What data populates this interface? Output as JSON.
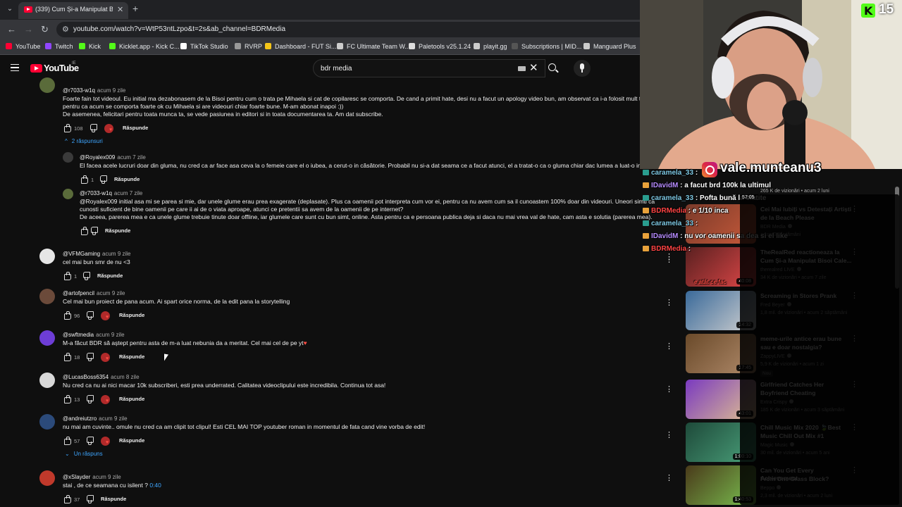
{
  "browser": {
    "tab_title": "(339) Cum Și-a Manipulat Bisoi",
    "url": "youtube.com/watch?v=WtP53ntLzpo&t=2s&ab_channel=BDRMedia",
    "bookmarks": [
      {
        "label": "YouTube",
        "color": "#ff0033"
      },
      {
        "label": "Twitch",
        "color": "#9146ff"
      },
      {
        "label": "Kick",
        "color": "#53fc18"
      },
      {
        "label": "Kicklet.app - Kick C...",
        "color": "#53fc18"
      },
      {
        "label": "TikTok Studio",
        "color": "#ffffff"
      },
      {
        "label": "RVRP",
        "color": "#999999"
      },
      {
        "label": "Dashboard - FUT Si...",
        "color": "#f5c518"
      },
      {
        "label": "FC Ultimate Team W...",
        "color": "#cccccc"
      },
      {
        "label": "Paletools v25.1.24",
        "color": "#dddddd"
      },
      {
        "label": "playit.gg",
        "color": "#cccccc"
      },
      {
        "label": "Subscriptions | MID...",
        "color": "#555555"
      },
      {
        "label": "Manguard Plus",
        "color": "#cccccc"
      }
    ]
  },
  "masthead": {
    "logo_text": "YouTube",
    "logo_country": "IE",
    "search_value": "bdr media"
  },
  "comments": [
    {
      "author": "@r7033-w1q",
      "time": "acum 9 zile",
      "lines": [
        "Foarte fain tot videoul. Eu initial ma dezabonasem de la Bisoi pentru cum o trata pe Mihaela si cat de copilaresc se comporta. De cand a primit hate, desi nu a facut un apology video bun, am observat ca i-a folosit mult tot",
        "pentru ca acum se comporta foarte ok cu Mihaela si are videouri chiar foarte bune. M-am abonat inapoi :))",
        "De asemenea, felicitari pentru toata munca ta, se vede pasiunea in editori si in toata documentarea ta. Am dat subscribe."
      ],
      "likes": "108",
      "reply": "Răspunde",
      "replies_toggle": "2 răspunsuri"
    },
    {
      "author": "@Royalex009",
      "time": "acum 7 zile",
      "lines": [
        "El facea acele lucruri doar din gluma, nu cred ca ar face asa ceva la o femeie care el o iubea, a cerut-o in căsătorie. Probabil nu si-a dat seama ce a facut atunci, el a tratat-o ca o gluma chiar dac lumea a luat-o in seri"
      ],
      "likes": "1",
      "reply": "Răspunde"
    },
    {
      "author": "@r7033-w1q",
      "time": "acum 7 zile",
      "lines": [
        "@Royalex009 initial asa mi se parea si mie, dar unele glume erau prea exagerate (deplasate). Plus ca oamenii pot interpreta cum vor ei, pentru ca nu avem cum sa il cunoastem 100% doar din videouri. Uneori simti ca",
        "cunosti suficient de bine oamenii pe care ii ai de o viata aproape, atunci ce pretentii sa avem de la oamenii de pe internet?",
        "De aceea, parerea mea e ca unele glume trebuie tinute doar offline, iar glumele care sunt cu bun simt, online. Asta pentru ca e persoana publica deja si daca nu mai vrea val de hate, cam asta e solutia (parerea mea)."
      ],
      "likes": "",
      "reply": "Răspunde"
    },
    {
      "author": "@VFMGaming",
      "time": "acum 9 zile",
      "lines": [
        "cel mai bun smr de nu <3"
      ],
      "likes": "1",
      "reply": "Răspunde"
    },
    {
      "author": "@artofpencil",
      "time": "acum 9 zile",
      "lines": [
        "Cel mai bun proiect de pana acum. Ai spart orice norma, de la edit pana la storytelling"
      ],
      "likes": "96",
      "reply": "Răspunde"
    },
    {
      "author": "@swftmedia",
      "time": "acum 9 zile",
      "lines": [
        "M-a făcut BDR să aștept pentru asta de m-a luat nebunia da a meritat. Cel mai cel de pe yt"
      ],
      "likes": "18",
      "reply": "Răspunde"
    },
    {
      "author": "@LucasBoss6354",
      "time": "acum 8 zile",
      "lines": [
        "Nu cred ca nu ai nici macar 10k subscriberi, esti prea underrated. Calitatea videoclipului este incredibila. Continua tot asa!"
      ],
      "likes": "13",
      "reply": "Răspunde"
    },
    {
      "author": "@andreiutzro",
      "time": "acum 9 zile",
      "lines": [
        "nu mai am cuvinte.. omule nu cred ca am clipit tot clipul! Esti CEL MAI TOP youtuber roman in momentul de fata cand vine vorba de edit!"
      ],
      "likes": "57",
      "reply": "Răspunde",
      "replies_toggle": "Un răspuns"
    },
    {
      "author": "@xSlayder",
      "time": "acum 9 zile",
      "lines": [
        "stai , de ce seamana cu isilent ?"
      ],
      "timestamp_link": "0:40",
      "likes": "37",
      "reply": "Răspunde"
    }
  ],
  "sidebar": [
    {
      "title": [
        "Cei Mai Iubiți vs Detestați Artiști",
        "de la Beach Please"
      ],
      "channel": "BDR Media",
      "meta": "acum 3 săptămâni",
      "duration": ""
    },
    {
      "title": [
        "TheRealRed reactioneaza la",
        "Cum Și-a Manipulat Bisoi Cale..."
      ],
      "channel": "therealred LIVE",
      "meta": "34 K de vizionări • acum 7 zile",
      "duration": "40:08"
    },
    {
      "title": [
        "Screaming in Stores Prank"
      ],
      "channel": "Fred Beyer",
      "meta": "1,8 mil. de vizionări • acum 2 săptămâni",
      "duration": "14:32"
    },
    {
      "title": [
        "meme-urile antice erau bune",
        "sau e doar nostalgia?"
      ],
      "channel": "ZappyLIVE",
      "meta": "5,9 K de vizionări • acum 1 zi",
      "duration": "17:45",
      "badge": "Nou"
    },
    {
      "title": [
        "Girlfriend Catches Her",
        "Boyfriend Cheating"
      ],
      "channel": "Extra Crispy",
      "meta": "185 K de vizionări • acum 3 săptămâni",
      "duration": "43:01"
    },
    {
      "title": [
        "Chill Music Mix 2020 🍃Best",
        "Music Chill Out Mix #1"
      ],
      "channel": "Magic Music",
      "meta": "30 mil. de vizionări • acum 5 ani",
      "duration": "1:00:10"
    },
    {
      "title": [
        "Can You Get Every Achievement",
        "From One Grass Block?"
      ],
      "channel": "Beppo",
      "meta": "2,3 mil. de vizionări • acum 2 luni",
      "duration": "1:40:53"
    }
  ],
  "sidebar_partial": {
    "meta": "265 K de vizionări • acum 2 luni",
    "duration": "57:05"
  },
  "stream": {
    "viewer_count": "15",
    "instagram": "vale.munteanu3",
    "chat": [
      {
        "user": "caramela_33",
        "msg": ":",
        "color": "#7ec8e3"
      },
      {
        "user": "IDavidM",
        "msg": ": a facut brd 100k la ultimul",
        "color": "#b78cff"
      },
      {
        "user": "caramela_33",
        "msg": ": Pofta bună la clatite",
        "color": "#7ec8e3"
      },
      {
        "user": "BDRMedia",
        "msg": ": e 1/10 inca",
        "color": "#ff4444"
      },
      {
        "user": "caramela_33",
        "msg": ":",
        "color": "#7ec8e3"
      },
      {
        "user": "IDavidM",
        "msg": ": nu vor oamenii sa dea si el like",
        "color": "#b78cff"
      },
      {
        "user": "BDRMedia",
        "msg": ":",
        "color": "#ff4444"
      }
    ],
    "overlay_text": "e atât ce fac"
  }
}
